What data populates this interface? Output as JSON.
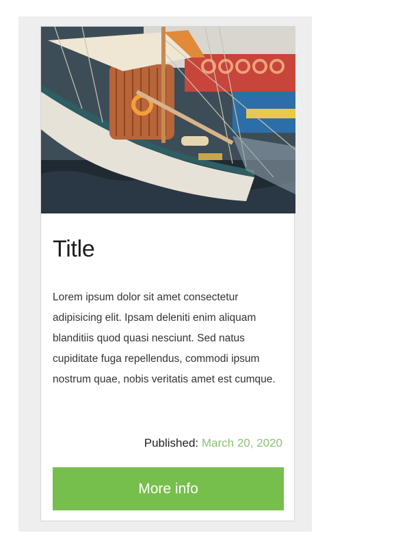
{
  "card": {
    "image_alt": "sailing-boat-photo",
    "title": "Title",
    "body": "Lorem ipsum dolor sit amet consectetur adipisicing elit. Ipsam deleniti enim aliquam blanditiis quod quasi nesciunt. Sed natus cupiditate fuga repellendus, commodi ipsum nostrum quae, nobis veritatis amet est cumque.",
    "published_label": "Published:",
    "published_date": "March 20, 2020",
    "button_label": "More info"
  },
  "colors": {
    "accent": "#77bf4c",
    "date": "#8cc176",
    "frame_background": "#eeeeee"
  }
}
